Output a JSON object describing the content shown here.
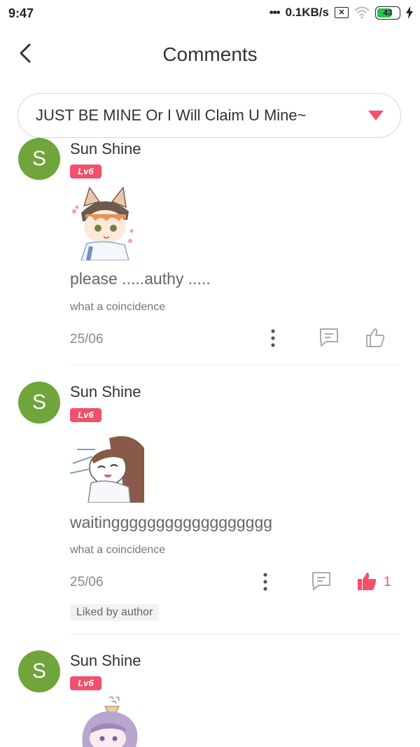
{
  "status_bar": {
    "time": "9:47",
    "network_speed": "0.1KB/s",
    "battery": "43"
  },
  "header": {
    "title": "Comments"
  },
  "selector": {
    "value": "JUST BE MINE Or I Will Claim U Mine~"
  },
  "comments": [
    {
      "avatar_letter": "S",
      "name": "Sun Shine",
      "level": "Lv6",
      "text": "please .....authy .....",
      "sub": "what a coincidence",
      "date": "25/06",
      "liked": false,
      "likes": ""
    },
    {
      "avatar_letter": "S",
      "name": "Sun Shine",
      "level": "Lv6",
      "text": "waitingggggggggggggggggg",
      "sub": "what a coincidence",
      "date": "25/06",
      "liked": true,
      "likes": "1",
      "badge": "Liked by author"
    },
    {
      "avatar_letter": "S",
      "name": "Sun Shine",
      "level": "Lv6"
    }
  ],
  "colors": {
    "accent": "#f2506b",
    "avatar": "#6fa53b"
  }
}
